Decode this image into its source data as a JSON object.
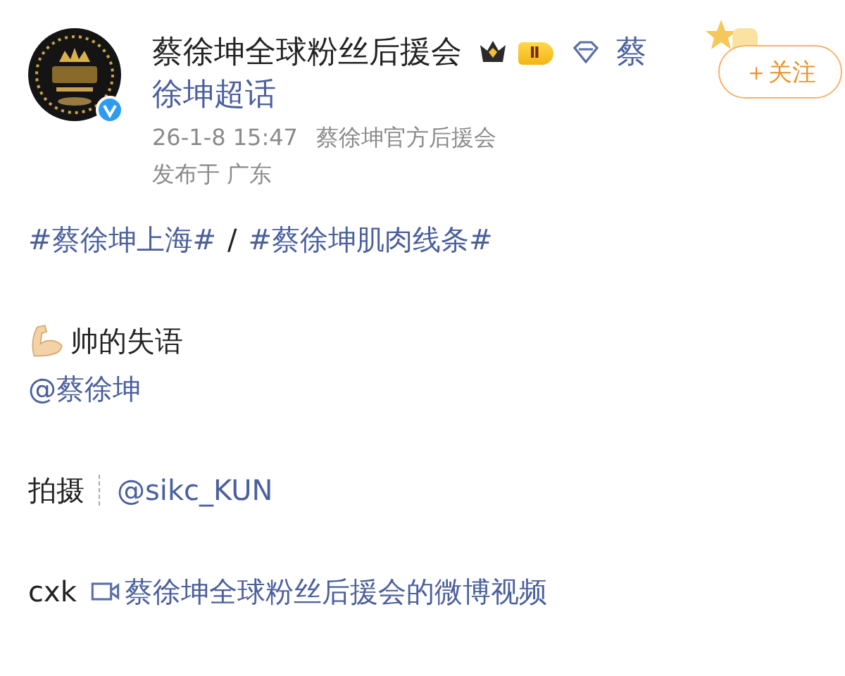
{
  "author": {
    "name": "蔡徐坤全球粉丝后援会",
    "verified": true,
    "level_badge": "Ⅱ",
    "topic_link_lines": [
      "蔡",
      "徐坤超话"
    ],
    "follow_button": "＋关注"
  },
  "meta": {
    "time": "26-1-8 15:47",
    "source": "蔡徐坤官方后援会",
    "location": "发布于 广东"
  },
  "body": [
    {
      "kind": "hashtags",
      "parts": [
        "#蔡徐坤上海#",
        "/",
        "#蔡徐坤肌肉线条#"
      ]
    },
    {
      "kind": "caption",
      "text": "帅的失语"
    },
    {
      "kind": "mention",
      "text": "@蔡徐坤"
    },
    {
      "kind": "credit",
      "label": "拍摄",
      "link": "@sikc_KUN"
    },
    {
      "kind": "video",
      "label": "cxk",
      "link": "蔡徐坤全球粉丝后援会的微博视频"
    }
  ]
}
